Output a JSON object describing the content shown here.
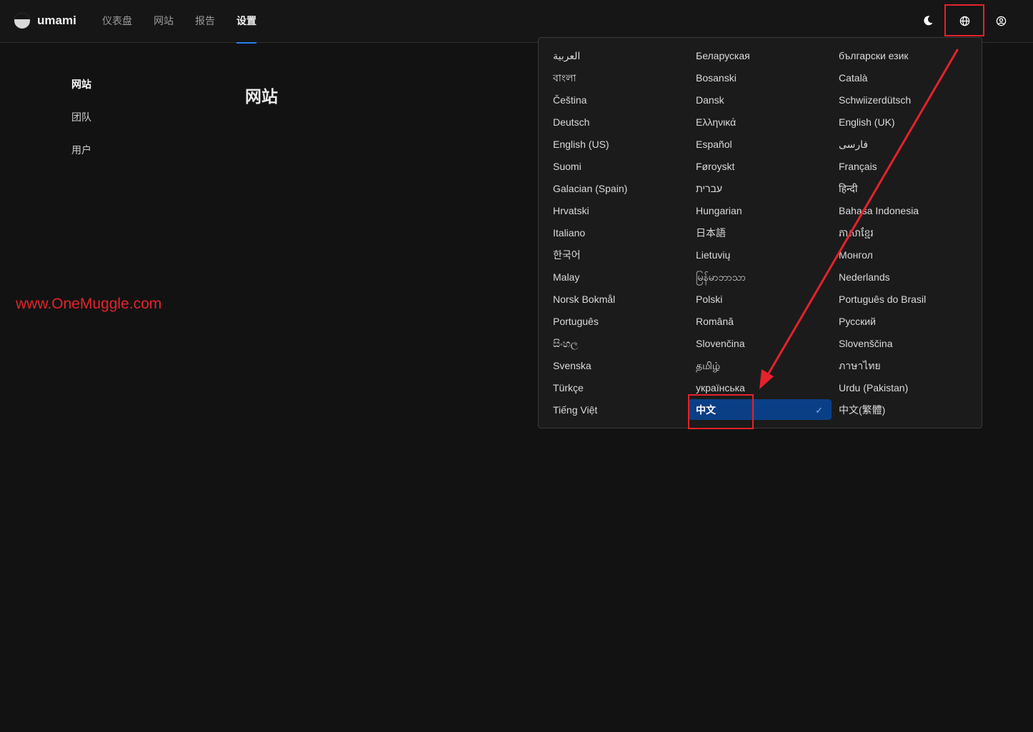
{
  "app": {
    "name": "umami"
  },
  "nav": {
    "items": [
      "仪表盘",
      "网站",
      "报告",
      "设置"
    ]
  },
  "sidebar": {
    "items": [
      "网站",
      "团队",
      "用户"
    ]
  },
  "page": {
    "title": "网站"
  },
  "watermark": "www.OneMuggle.com",
  "language_menu": {
    "selected": "中文",
    "check_glyph": "✓",
    "options": [
      "العربية",
      "Беларуская",
      "български език",
      "বাংলা",
      "Bosanski",
      "Català",
      "Čeština",
      "Dansk",
      "Schwiizerdütsch",
      "Deutsch",
      "Ελληνικά",
      "English (UK)",
      "English (US)",
      "Español",
      "فارسی",
      "Suomi",
      "Føroyskt",
      "Français",
      "Galacian (Spain)",
      "עברית",
      "हिन्दी",
      "Hrvatski",
      "Hungarian",
      "Bahasa Indonesia",
      "Italiano",
      "日本語",
      "ភាសាខ្មែរ",
      "한국어",
      "Lietuvių",
      "Монгол",
      "Malay",
      "မြန်မာဘာသာ",
      "Nederlands",
      "Norsk Bokmål",
      "Polski",
      "Português do Brasil",
      "Português",
      "Română",
      "Русский",
      "සිංහල",
      "Slovenčina",
      "Slovenščina",
      "Svenska",
      "தமிழ்",
      "ภาษาไทย",
      "Türkçe",
      "українська",
      "Urdu (Pakistan)",
      "Tiếng Việt",
      "中文",
      "中文(繁體)"
    ]
  },
  "icons": {
    "theme": "moon-icon",
    "language": "globe-icon",
    "profile": "user-circle-icon"
  },
  "colors": {
    "accent": "#2680eb",
    "selected_bg": "#0a3f86",
    "annotation": "#e5222b",
    "background": "#121212"
  }
}
